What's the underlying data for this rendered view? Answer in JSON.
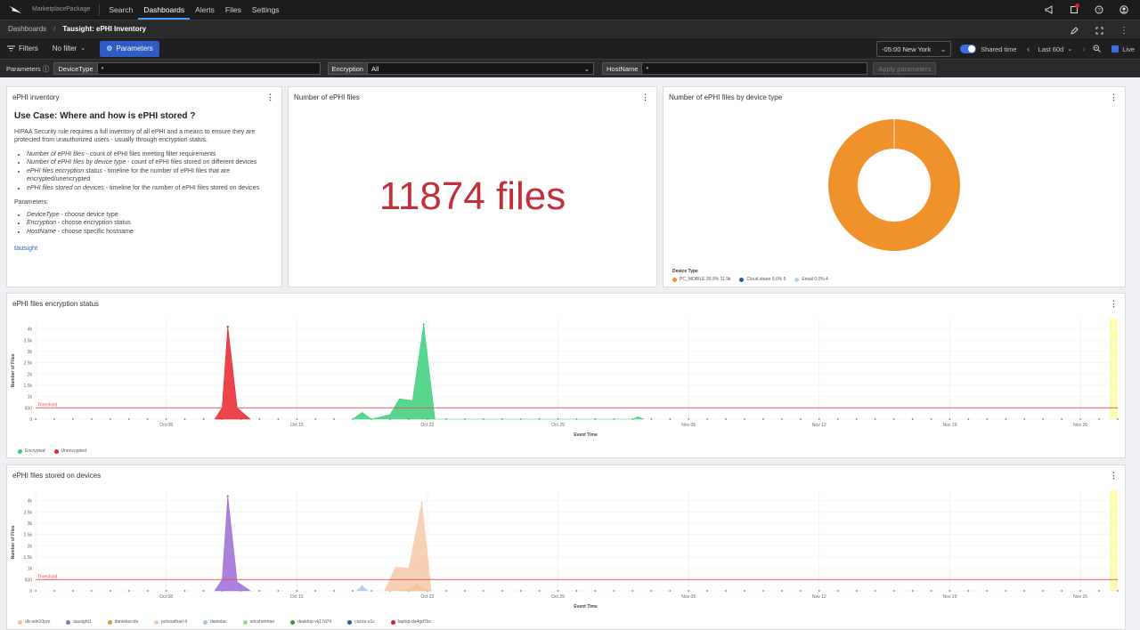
{
  "topnav": {
    "package": "MarketplacePackage",
    "links": [
      "Search",
      "Dashboards",
      "Alerts",
      "Files",
      "Settings"
    ],
    "active": "Dashboards",
    "icons": [
      "megaphone-icon",
      "notification-icon",
      "help-icon",
      "user-icon"
    ]
  },
  "breadcrumb": {
    "root": "Dashboards",
    "sep": "/",
    "title": "Tausight: ePHI Inventory"
  },
  "filterbar": {
    "filters_label": "Filters",
    "no_filter_label": "No filter",
    "parameters_label": "Parameters",
    "timezone": "-05:00 New York",
    "shared_time_label": "Shared time",
    "range": "Last 60d",
    "live_label": "Live"
  },
  "params": {
    "label": "Parameters",
    "device_type_label": "DeviceType",
    "device_type_value": "*",
    "encryption_label": "Encryption",
    "encryption_value": "All",
    "hostname_label": "HostName",
    "hostname_value": "*",
    "apply_label": "Apply parameters"
  },
  "inventory_panel": {
    "title": "ePHI inventory",
    "heading": "Use Case: Where and how is ePHI stored ?",
    "intro": "HIPAA Security rule requires a full inventory of all ePHI and a means to ensure they are protected from unauthorized users - usually through encryption status.",
    "bullets": [
      {
        "em": "Number of ePHI files",
        "rest": " - count of ePHI files meeting filter requirements"
      },
      {
        "em": "Number of ePHI files by device type",
        "rest": " - count of ePHI files stored on different devices"
      },
      {
        "em": "ePHI files encryption status",
        "rest": " - timeline for the number of ePHI files that are encrypted/unencrypted"
      },
      {
        "em": "ePHI files stored on devices",
        "rest": " - timeline for the number of ePHI files stored on devices"
      }
    ],
    "params_heading": "Parameters:",
    "param_bullets": [
      {
        "em": "DeviceType",
        "rest": " - choose device type"
      },
      {
        "em": "Encryption",
        "rest": " - choose encryption status"
      },
      {
        "em": "HostName",
        "rest": " - choose specific hostname"
      }
    ],
    "link": "tausight"
  },
  "count_panel": {
    "title": "Number of ePHI files",
    "value": "11874 files"
  },
  "pie_panel": {
    "title": "Number of ePHI files by device type",
    "legend_title": "Device Type"
  },
  "enc_panel": {
    "title": "ePHI files encryption status",
    "threshold_label": "Threshold"
  },
  "dev_panel": {
    "title": "ePHI files stored on devices",
    "threshold_label": "Threshold"
  },
  "colors": {
    "encrypted": "#3ccf7a",
    "unencrypted": "#e8232a",
    "pc_mobile": "#f0922b",
    "cloud": "#1f5fa8",
    "email": "#a8d8f0",
    "threshold": "#e05050",
    "accent": "#2f5bc4"
  },
  "chart_data": [
    {
      "type": "pie",
      "title": "Number of ePHI files by device type",
      "legend_title": "Device Type",
      "slices": [
        {
          "name": "PC_MOBILE",
          "pct": "99.9%",
          "label": "11.9k",
          "value": 11865
        },
        {
          "name": "Cloud share",
          "pct": "0.0%",
          "label": "5",
          "value": 5
        },
        {
          "name": "Email",
          "pct": "0.0%",
          "label": "4",
          "value": 4
        }
      ]
    },
    {
      "type": "area",
      "title": "ePHI files encryption status",
      "xlabel": "Event Time",
      "ylabel": "Number of Files",
      "yticks": [
        "0",
        "500",
        "1k",
        "1.5k",
        "2k",
        "2.5k",
        "3k",
        "3.5k",
        "4k"
      ],
      "ylim": [
        0,
        4300
      ],
      "xticks": [
        "Oct 08",
        "Oct 15",
        "Oct 22",
        "Oct 29",
        "Nov 05",
        "Nov 12",
        "Nov 19",
        "Nov 26"
      ],
      "threshold": 500,
      "series": [
        {
          "name": "Encrypted",
          "points": [
            [
              17.0,
              0
            ],
            [
              17.5,
              300
            ],
            [
              18.0,
              0
            ],
            [
              19.0,
              200
            ],
            [
              19.5,
              900
            ],
            [
              20.2,
              820
            ],
            [
              20.8,
              4200
            ],
            [
              21.4,
              0
            ],
            [
              32.0,
              0
            ],
            [
              32.3,
              100
            ],
            [
              32.6,
              0
            ]
          ]
        },
        {
          "name": "Unencrypted",
          "points": [
            [
              9.6,
              0
            ],
            [
              10.0,
              500
            ],
            [
              10.3,
              4100
            ],
            [
              10.8,
              500
            ],
            [
              11.5,
              0
            ]
          ]
        }
      ]
    },
    {
      "type": "area",
      "title": "ePHI files stored on devices",
      "xlabel": "Event Time",
      "ylabel": "Number of Files",
      "yticks": [
        "0",
        "500",
        "1k",
        "1.5k",
        "2k",
        "2.5k",
        "3k",
        "3.5k",
        "4k"
      ],
      "ylim": [
        0,
        4300
      ],
      "xticks": [
        "Oct 08",
        "Oct 15",
        "Oct 22",
        "Oct 29",
        "Nov 05",
        "Nov 12",
        "Nov 19",
        "Nov 26"
      ],
      "threshold": 500,
      "series": [
        {
          "name": "dlc-win10pro",
          "color": "#f5c48a",
          "points": []
        },
        {
          "name": "tausight1",
          "color": "#9b6bd6",
          "points": [
            [
              9.6,
              0
            ],
            [
              10.0,
              500
            ],
            [
              10.3,
              4200
            ],
            [
              10.8,
              400
            ],
            [
              11.5,
              0
            ]
          ]
        },
        {
          "name": "danielaccds",
          "color": "#e8963a",
          "points": [
            [
              19.5,
              0
            ],
            [
              20.1,
              100
            ],
            [
              20.4,
              300
            ],
            [
              20.8,
              100
            ],
            [
              21.2,
              0
            ]
          ]
        },
        {
          "name": "pchoudhari-lt",
          "color": "#f7c9a8",
          "points": [
            [
              18.7,
              0
            ],
            [
              19.3,
              1050
            ],
            [
              20.0,
              1000
            ],
            [
              20.7,
              3900
            ],
            [
              21.2,
              0
            ]
          ]
        },
        {
          "name": "danielac",
          "color": "#a8c8e8",
          "points": [
            [
              17.2,
              0
            ],
            [
              17.5,
              200
            ],
            [
              17.8,
              0
            ]
          ]
        },
        {
          "name": "ericsherman",
          "color": "#90d890",
          "points": []
        },
        {
          "name": "desktop-vk17d74",
          "color": "#2a9a4a",
          "points": []
        },
        {
          "name": "cuzzo-x1c",
          "color": "#1f5fa8",
          "points": []
        },
        {
          "name": "laptop-da4gd7bc",
          "color": "#d02030",
          "points": []
        }
      ]
    }
  ]
}
